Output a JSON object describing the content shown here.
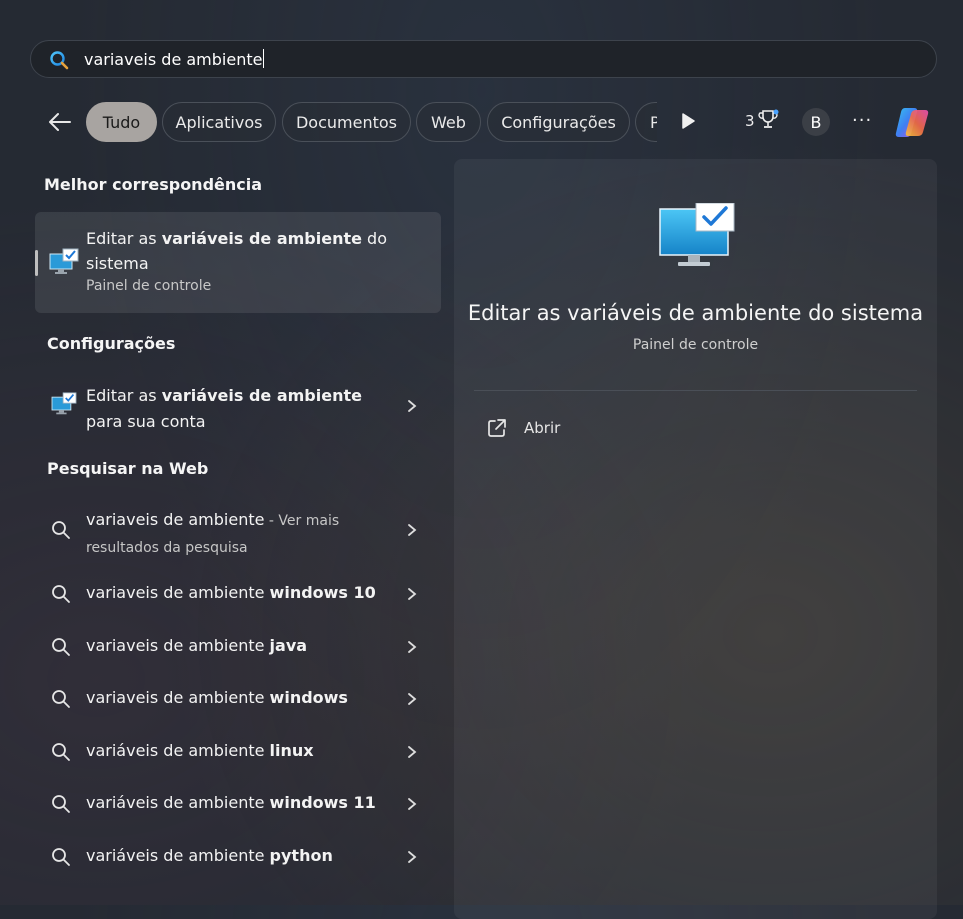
{
  "search": {
    "value": "variaveis de ambiente"
  },
  "filters": [
    {
      "label": "Tudo",
      "active": true
    },
    {
      "label": "Aplicativos"
    },
    {
      "label": "Documentos"
    },
    {
      "label": "Web"
    },
    {
      "label": "Configurações"
    },
    {
      "label": "P"
    }
  ],
  "toolbar": {
    "trophy_count": "3",
    "avatar_initial": "B",
    "more": "···"
  },
  "sections": {
    "best_match": "Melhor correspondência",
    "settings": "Configurações",
    "web": "Pesquisar na Web"
  },
  "best_match": {
    "pre": "Editar as ",
    "bold": "variáveis de ambiente",
    "post": " do sistema",
    "subtitle": "Painel de controle"
  },
  "settings_item": {
    "pre": "Editar as ",
    "bold": "variáveis de ambiente",
    "line2": "para sua conta"
  },
  "web_results": [
    {
      "text": "variaveis de ambiente",
      "suffix": " - Ver mais",
      "line2": "resultados da pesquisa"
    },
    {
      "text": "variaveis de ambiente ",
      "bold": "windows 10"
    },
    {
      "text": "variaveis de ambiente ",
      "bold": "java"
    },
    {
      "text": "variaveis de ambiente ",
      "bold": "windows"
    },
    {
      "text": "variáveis de ambiente ",
      "bold": "linux"
    },
    {
      "text": "variáveis de ambiente ",
      "bold": "windows 11"
    },
    {
      "text": "variáveis de ambiente ",
      "bold": "python"
    }
  ],
  "preview": {
    "title": "Editar as variáveis de ambiente do sistema",
    "subtitle": "Painel de controle",
    "action": "Abrir"
  }
}
